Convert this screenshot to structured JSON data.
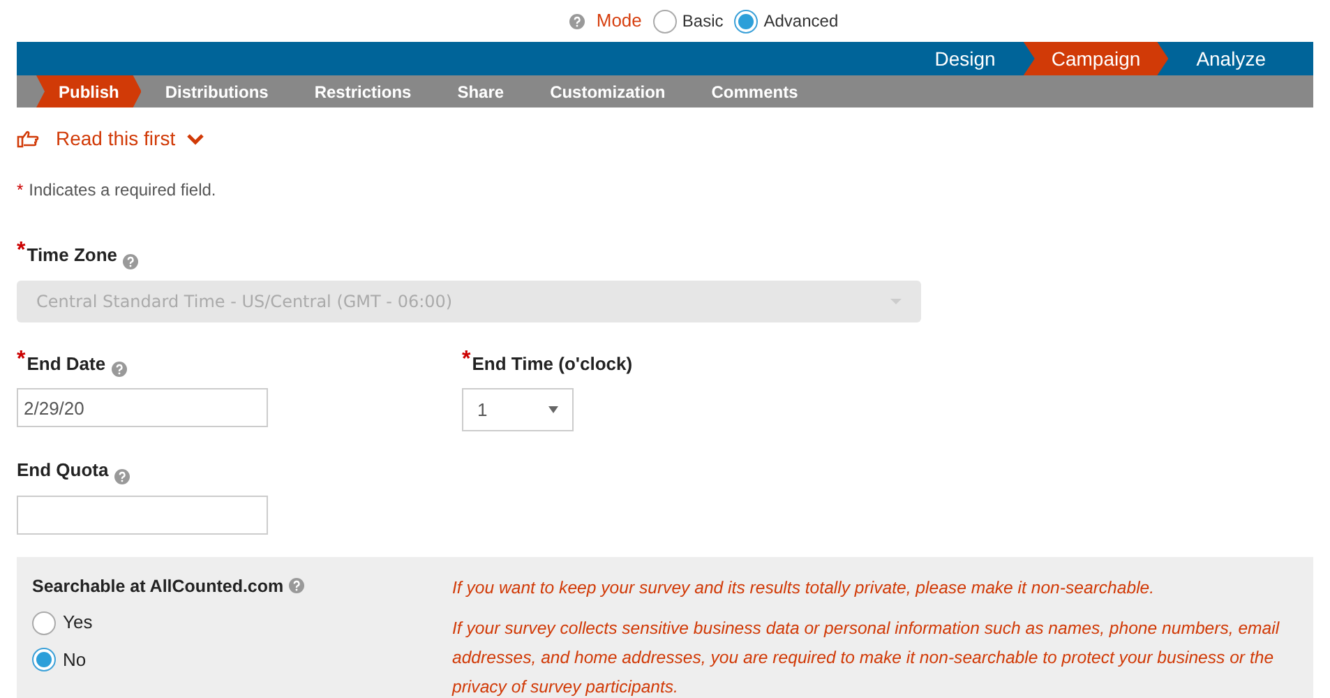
{
  "mode": {
    "label": "Mode",
    "help": true,
    "options": [
      {
        "label": "Basic",
        "selected": false
      },
      {
        "label": "Advanced",
        "selected": true
      }
    ]
  },
  "main_tabs": [
    {
      "label": "Design",
      "selected": false
    },
    {
      "label": "Campaign",
      "selected": true
    },
    {
      "label": "Analyze",
      "selected": false
    }
  ],
  "sub_tabs": [
    {
      "label": "Publish",
      "selected": true
    },
    {
      "label": "Distributions",
      "selected": false
    },
    {
      "label": "Restrictions",
      "selected": false
    },
    {
      "label": "Share",
      "selected": false
    },
    {
      "label": "Customization",
      "selected": false
    },
    {
      "label": "Comments",
      "selected": false
    }
  ],
  "read_first": {
    "label": "Read this first",
    "expanded": false
  },
  "required_note": {
    "mark": "*",
    "text": "Indicates a required field."
  },
  "time_zone": {
    "mark": "*",
    "label": "Time Zone",
    "help": true,
    "value": "Central Standard Time - US/Central (GMT - 06:00)",
    "disabled": true
  },
  "end_date": {
    "mark": "*",
    "label": "End Date",
    "help": true,
    "value": "2/29/20"
  },
  "end_time": {
    "mark": "*",
    "label": "End Time (o'clock)",
    "help": false,
    "value": "1"
  },
  "end_quota": {
    "label": "End Quota",
    "help": true
  },
  "searchable": {
    "label": "Searchable at AllCounted.com",
    "help": true,
    "options": [
      {
        "label": "Yes",
        "selected": false
      },
      {
        "label": "No",
        "selected": true
      }
    ],
    "notes": [
      "If you want to keep your survey and its results totally private, please make it non-searchable.",
      "If your survey collects sensitive business data or personal information such as names, phone numbers, email addresses, and home addresses, you are required to make it non-searchable to protect your business or the privacy of survey participants."
    ]
  }
}
